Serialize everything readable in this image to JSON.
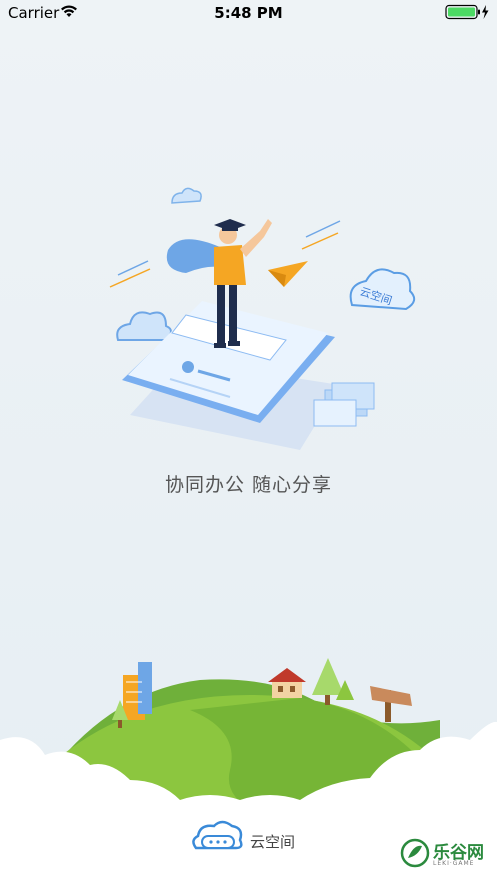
{
  "status_bar": {
    "carrier": "Carrier",
    "time": "5:48 PM"
  },
  "illustration": {
    "cloud_badge_text": "云空间"
  },
  "slogan": "协同办公 随心分享",
  "brand": {
    "name": "云空间"
  },
  "watermark": {
    "name": "乐谷网",
    "sub": "LEKI·GAME"
  },
  "colors": {
    "background": "#eaf1f5",
    "accent_blue": "#4f9be8",
    "grass_green": "#8cc63f",
    "shirt_orange": "#f5a623"
  }
}
